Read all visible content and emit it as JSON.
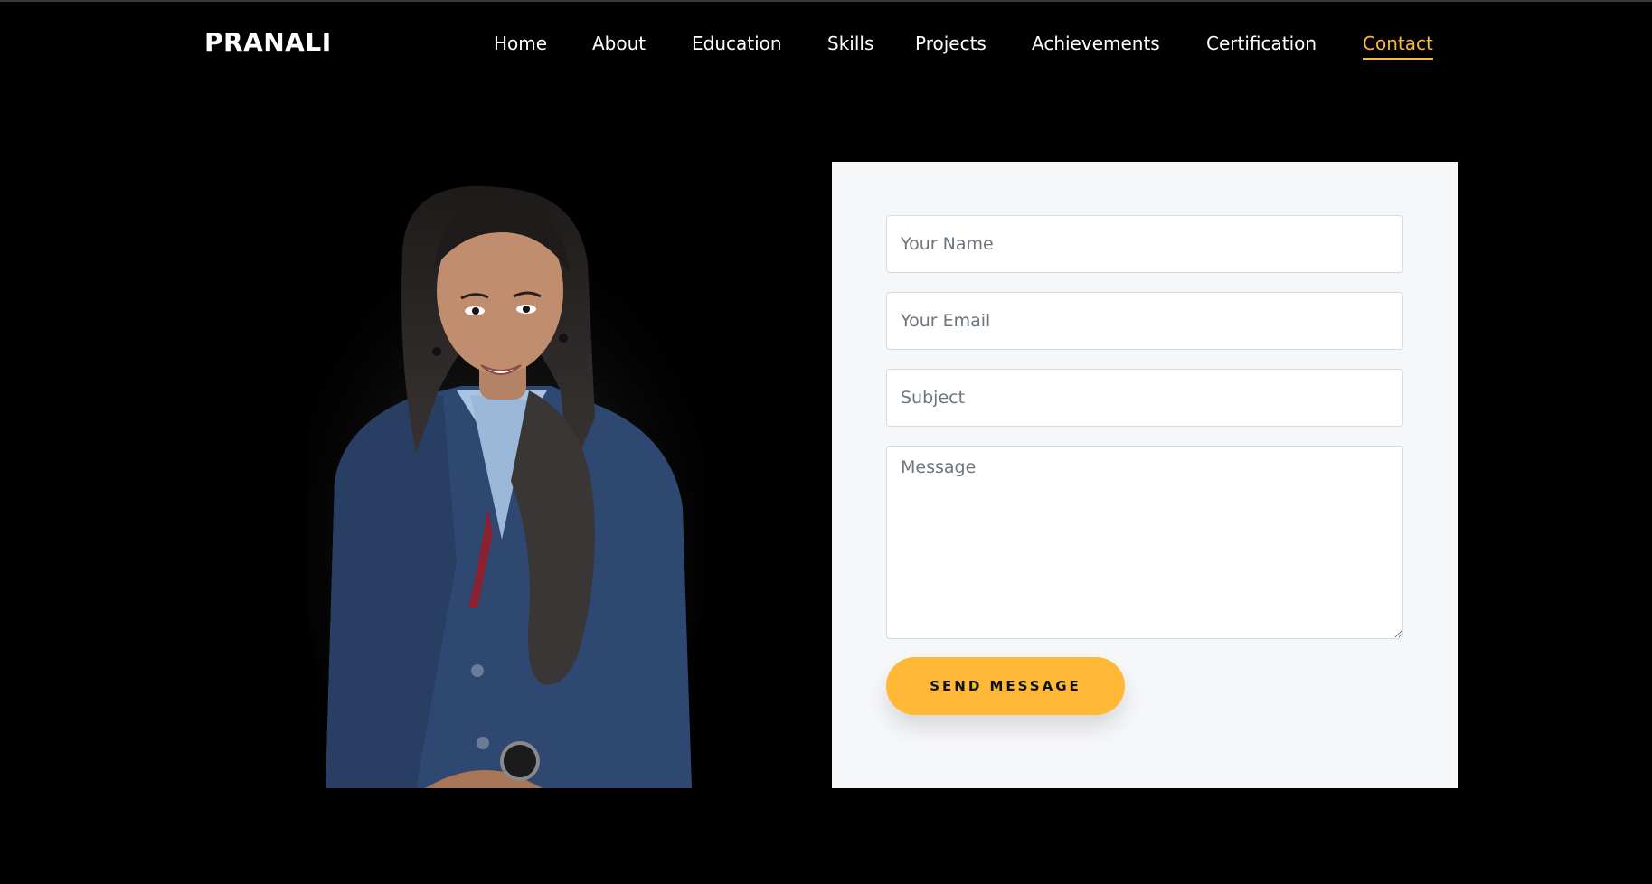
{
  "header": {
    "logo": "PRANALI"
  },
  "nav": {
    "items": [
      {
        "label": "Home"
      },
      {
        "label": "About"
      },
      {
        "label": "Education"
      },
      {
        "label": "Skills"
      },
      {
        "label": "Projects"
      },
      {
        "label": "Achievements"
      },
      {
        "label": "Certification"
      },
      {
        "label": "Contact",
        "active": true
      }
    ]
  },
  "contact_form": {
    "name_placeholder": "Your Name",
    "email_placeholder": "Your Email",
    "subject_placeholder": "Subject",
    "message_placeholder": "Message",
    "submit_label": "SEND MESSAGE"
  },
  "colors": {
    "background": "#000000",
    "accent": "#ffb836",
    "card": "#f6f7f9",
    "nav_text": "#ffffff"
  }
}
